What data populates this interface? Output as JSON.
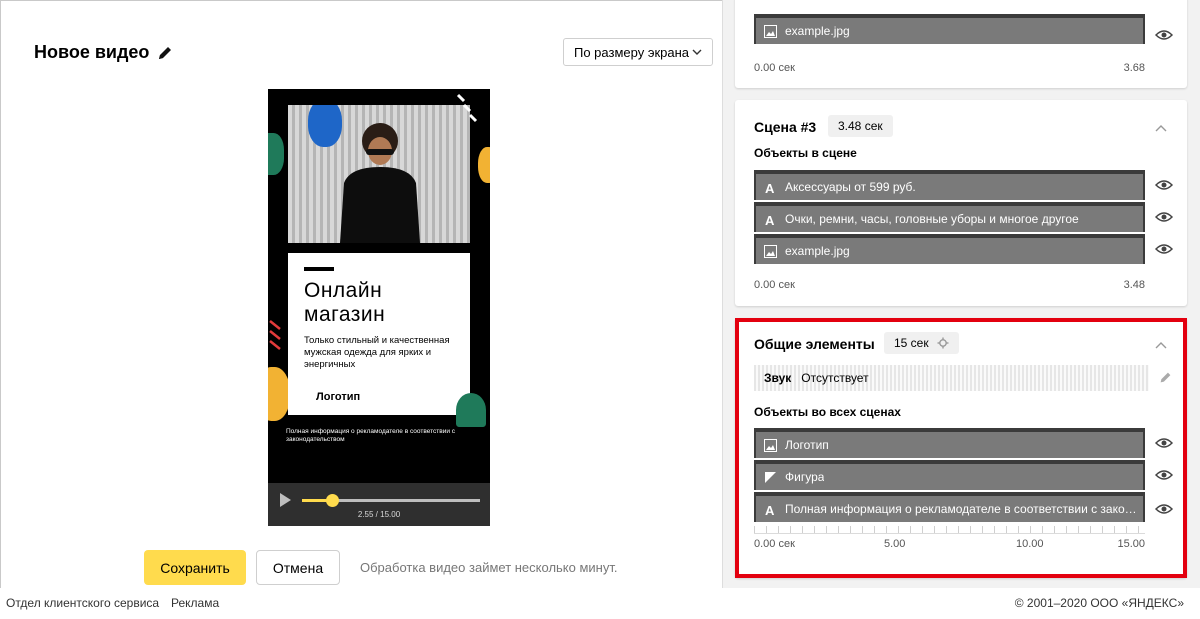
{
  "editor": {
    "title": "Новое видео",
    "view_select": "По размеру экрана",
    "preview": {
      "headline_line1": "Онлайн",
      "headline_line2": "магазин",
      "subtext": "Только стильный и качественная мужская одежда для ярких и энергичных",
      "logo_text": "Логотип",
      "disclaimer": "Полная информация о рекламодателе в соответствии с законодательством",
      "time_current": "2.55",
      "time_total": "15.00",
      "time_separator": "/",
      "progress": 0.17
    },
    "save_label": "Сохранить",
    "cancel_label": "Отмена",
    "processing_hint": "Обработка видео займет несколько минут."
  },
  "panel": {
    "scene2": {
      "objects": [
        {
          "icon": "image-icon",
          "label": "example.jpg"
        }
      ],
      "scale_start": "0.00 сек",
      "scale_end": "3.68"
    },
    "scene3": {
      "title": "Сцена #3",
      "duration": "3.48 сек",
      "objects_label": "Объекты в сцене",
      "objects": [
        {
          "icon": "text-icon",
          "label": "Аксессуары от 599 руб."
        },
        {
          "icon": "text-icon",
          "label": "Очки, ремни, часы, головные уборы и многое другое"
        },
        {
          "icon": "image-icon",
          "label": "example.jpg"
        }
      ],
      "scale_start": "0.00 сек",
      "scale_end": "3.48"
    },
    "common": {
      "title": "Общие элементы",
      "duration": "15 сек",
      "audio_label": "Звук",
      "audio_value": "Отсутствует",
      "objects_label": "Объекты во всех сценах",
      "objects": [
        {
          "icon": "image-icon",
          "label": "Логотип"
        },
        {
          "icon": "shape-icon",
          "label": "Фигура"
        },
        {
          "icon": "text-icon",
          "label": "Полная информация о рекламодателе в соответствии с законо..."
        }
      ],
      "scale": [
        "0.00 сек",
        "5.00",
        "10.00",
        "15.00"
      ]
    }
  },
  "footer": {
    "support": "Отдел клиентского сервиса",
    "ads": "Реклама",
    "copyright": "© 2001–2020 ООО «ЯНДЕКС»"
  },
  "colors": {
    "accent": "#ffdb4d",
    "highlight": "#e3000f",
    "row_bg": "#7a7a7a"
  }
}
